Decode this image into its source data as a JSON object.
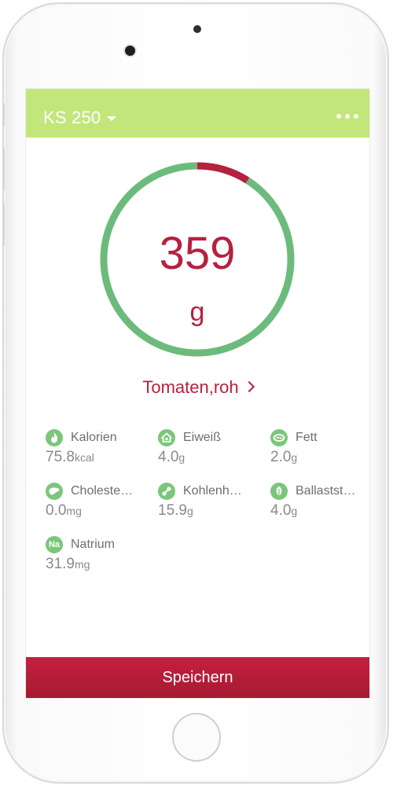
{
  "header": {
    "device_name": "KS 250",
    "background_color": "#c3e67a",
    "dropdown_icon": "caret-down-icon",
    "more_icon": "more-dots-icon"
  },
  "scale": {
    "value": "359",
    "unit": "g",
    "ring_red_fraction": 0.09,
    "ring_color": "#6dbb7c",
    "accent_color": "#b5213f"
  },
  "food": {
    "name": "Tomaten,roh",
    "chevron_icon": "chevron-right-icon"
  },
  "nutrients": [
    {
      "label": "Kalorien",
      "value": "75.8",
      "unit": "kcal",
      "icon": "flame-icon"
    },
    {
      "label": "Eiweiß",
      "value": "4.0",
      "unit": "g",
      "icon": "protein-icon"
    },
    {
      "label": "Fett",
      "value": "2.0",
      "unit": "g",
      "icon": "fat-icon"
    },
    {
      "label": "Choleste…",
      "value": "0.0",
      "unit": "mg",
      "icon": "liver-icon"
    },
    {
      "label": "Kohlenh…",
      "value": "15.9",
      "unit": "g",
      "icon": "carbohydrate-icon"
    },
    {
      "label": "Ballastst…",
      "value": "4.0",
      "unit": "g",
      "icon": "leaf-icon"
    },
    {
      "label": "Natrium",
      "value": "31.9",
      "unit": "mg",
      "icon": "sodium-icon",
      "badge": "Na"
    }
  ],
  "save": {
    "label": "Speichern",
    "color": "#b5213f"
  }
}
